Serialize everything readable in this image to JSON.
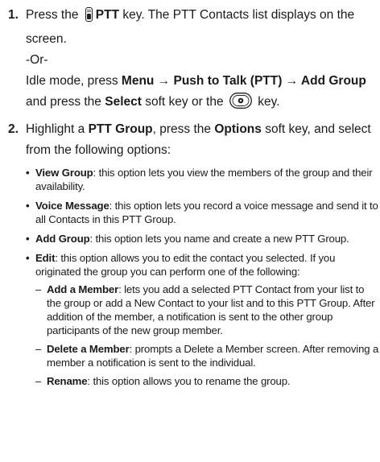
{
  "step1": {
    "number": "1.",
    "line_a_prefix": "Press the",
    "key_name": "PTT",
    "line_a_suffix": "key. The PTT Contacts list displays on the screen.",
    "or_text": "-Or-",
    "line_b_prefix": "Idle mode, press",
    "path": "Menu → Push to Talk (PTT) → Add Group",
    "line_b_mid": "and press the",
    "select_label": "Select",
    "line_b_mid2": "soft key or the",
    "line_b_suffix": "key."
  },
  "step2": {
    "number": "2.",
    "t1": "Highlight a",
    "group_label": "PTT Group",
    "t2": ", press the",
    "options_label": "Options",
    "t3": "soft key, and select from the following options:",
    "bullets": [
      {
        "term": "View Group",
        "desc": ": this option lets you view the members of the group and their availability."
      },
      {
        "term": "Voice Message",
        "desc": ": this option lets you record a voice message and send it to all Contacts in this PTT Group."
      },
      {
        "term": "Add Group",
        "desc": ": this option lets you name and create a new PTT Group."
      },
      {
        "term": "Edit",
        "desc": ": this option allows you to edit the contact you selected. If you originated the group you can perform one of the following:"
      }
    ],
    "sub_items": [
      {
        "term": "Add a Member",
        "desc": ": lets you add a selected PTT Contact from your list to the group or add a New Contact to your list and to this PTT Group. After addition of the member, a notification is sent to the other group participants of the new group member."
      },
      {
        "term": "Delete a Member",
        "desc": ": prompts a Delete a Member screen. After removing a member a notification is sent to the individual."
      },
      {
        "term": "Rename",
        "desc": ": this option allows you to rename the group."
      }
    ]
  }
}
